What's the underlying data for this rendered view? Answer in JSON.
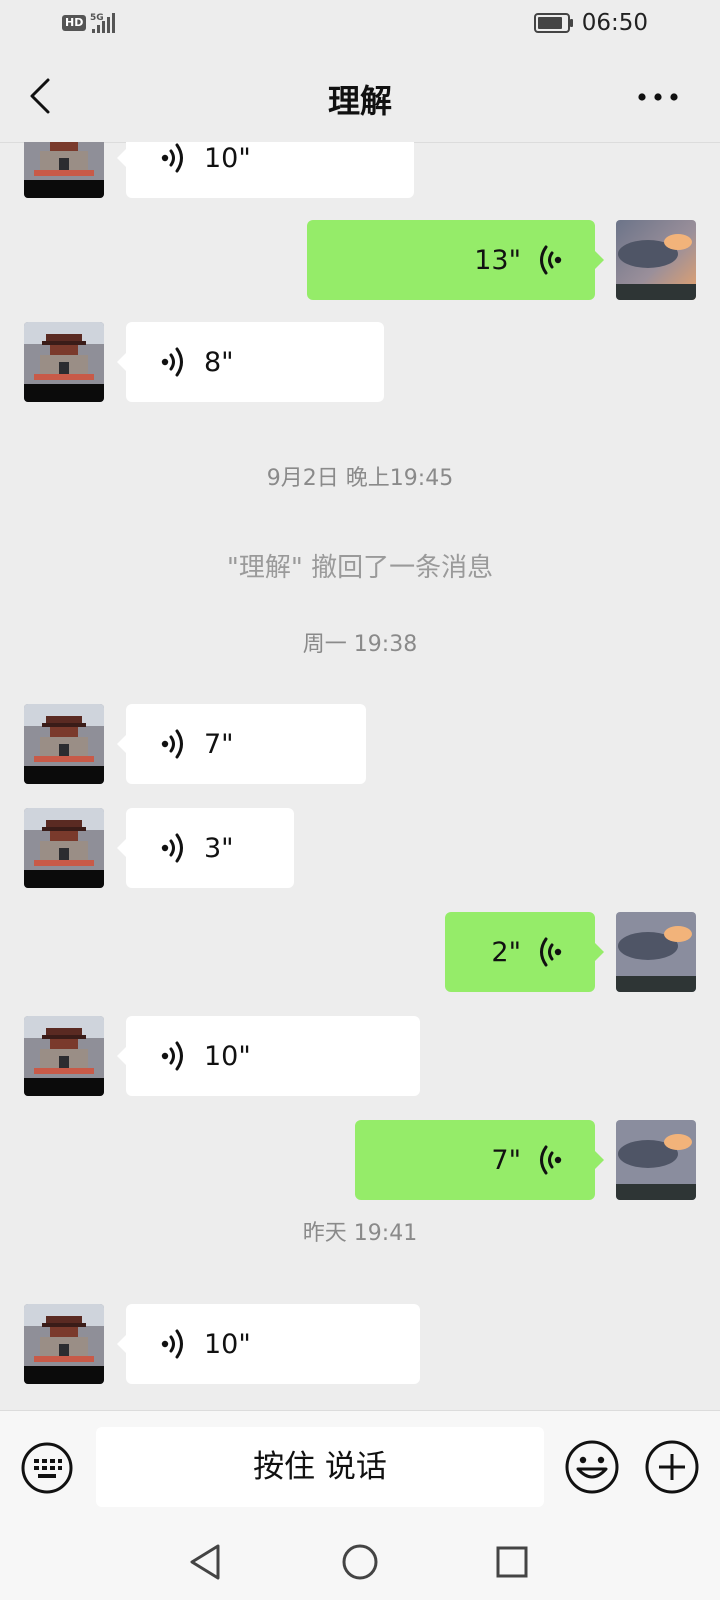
{
  "status_bar": {
    "network_badge": "HD",
    "network_type": "5G",
    "time": "06:50"
  },
  "header": {
    "title": "理解",
    "back_icon": "chevron-left-icon",
    "more_icon": "more-dots-icon"
  },
  "messages": [
    {
      "dir": "in",
      "duration": "10\""
    },
    {
      "dir": "out",
      "duration": "13\""
    },
    {
      "dir": "in",
      "duration": "8\""
    },
    {
      "dir": "in",
      "duration": "7\""
    },
    {
      "dir": "in",
      "duration": "3\""
    },
    {
      "dir": "out",
      "duration": "2\""
    },
    {
      "dir": "in",
      "duration": "10\""
    },
    {
      "dir": "out",
      "duration": "7\""
    },
    {
      "dir": "in",
      "duration": "10\""
    }
  ],
  "timestamps": [
    "9月2日 晚上19:45",
    "周一 19:38",
    "昨天 19:41"
  ],
  "system_message": "\"理解\" 撤回了一条消息",
  "input_bar": {
    "hold_to_talk": "按住 说话"
  },
  "colors": {
    "background": "#ededed",
    "bubble_out": "#95ec69",
    "bubble_in": "#ffffff",
    "meta_text": "#8a8a8a"
  }
}
